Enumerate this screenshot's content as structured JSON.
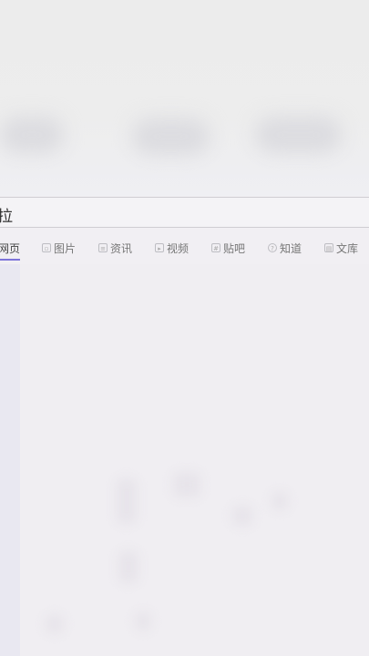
{
  "search": {
    "query": "拉"
  },
  "tabs": [
    {
      "label": "网页",
      "icon": "none",
      "active": true
    },
    {
      "label": "图片",
      "icon": "image-icon",
      "active": false
    },
    {
      "label": "资讯",
      "icon": "news-icon",
      "active": false
    },
    {
      "label": "视频",
      "icon": "video-icon",
      "active": false
    },
    {
      "label": "贴吧",
      "icon": "tieba-icon",
      "active": false
    },
    {
      "label": "知道",
      "icon": "question-icon",
      "active": false
    },
    {
      "label": "文库",
      "icon": "document-icon",
      "active": false
    }
  ],
  "colors": {
    "accent": "#7d74d9",
    "background": "#f1eff3"
  }
}
